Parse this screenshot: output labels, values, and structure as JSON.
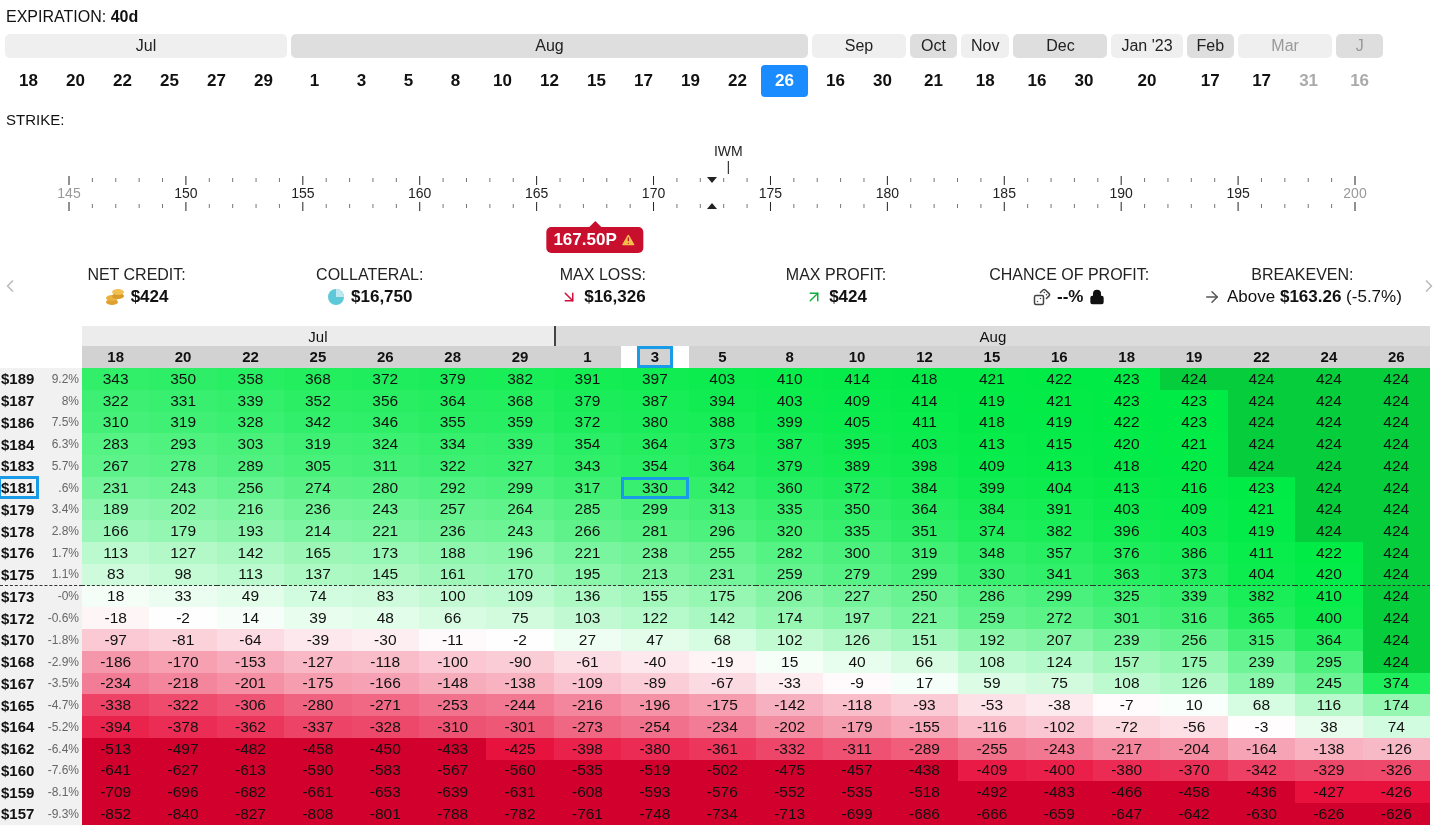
{
  "expiration": {
    "label": "EXPIRATION:",
    "days": "40d",
    "months": [
      {
        "label": "Jul",
        "dimmed": false,
        "dates": [
          {
            "label": "18",
            "selected": false,
            "dimmed": false
          },
          {
            "label": "20",
            "selected": false,
            "dimmed": false
          },
          {
            "label": "22",
            "selected": false,
            "dimmed": false
          },
          {
            "label": "25",
            "selected": false,
            "dimmed": false
          },
          {
            "label": "27",
            "selected": false,
            "dimmed": false
          },
          {
            "label": "29",
            "selected": false,
            "dimmed": false
          }
        ]
      },
      {
        "label": "Aug",
        "dimmed": false,
        "dates": [
          {
            "label": "1",
            "selected": false,
            "dimmed": false
          },
          {
            "label": "3",
            "selected": false,
            "dimmed": false
          },
          {
            "label": "5",
            "selected": false,
            "dimmed": false
          },
          {
            "label": "8",
            "selected": false,
            "dimmed": false
          },
          {
            "label": "10",
            "selected": false,
            "dimmed": false
          },
          {
            "label": "12",
            "selected": false,
            "dimmed": false
          },
          {
            "label": "15",
            "selected": false,
            "dimmed": false
          },
          {
            "label": "17",
            "selected": false,
            "dimmed": false
          },
          {
            "label": "19",
            "selected": false,
            "dimmed": false
          },
          {
            "label": "22",
            "selected": false,
            "dimmed": false
          },
          {
            "label": "26",
            "selected": true,
            "dimmed": false
          }
        ]
      },
      {
        "label": "Sep",
        "dimmed": false,
        "dates": [
          {
            "label": "16",
            "selected": false,
            "dimmed": false
          },
          {
            "label": "30",
            "selected": false,
            "dimmed": false
          }
        ]
      },
      {
        "label": "Oct",
        "dimmed": false,
        "dates": [
          {
            "label": "21",
            "selected": false,
            "dimmed": false
          }
        ]
      },
      {
        "label": "Nov",
        "dimmed": false,
        "dates": [
          {
            "label": "18",
            "selected": false,
            "dimmed": false
          }
        ]
      },
      {
        "label": "Dec",
        "dimmed": false,
        "dates": [
          {
            "label": "16",
            "selected": false,
            "dimmed": false
          },
          {
            "label": "30",
            "selected": false,
            "dimmed": false
          }
        ]
      },
      {
        "label": "Jan '23",
        "dimmed": false,
        "dates": [
          {
            "label": "20",
            "selected": false,
            "dimmed": false
          }
        ]
      },
      {
        "label": "Feb",
        "dimmed": false,
        "dates": [
          {
            "label": "17",
            "selected": false,
            "dimmed": false
          }
        ]
      },
      {
        "label": "Mar",
        "dimmed": true,
        "dates": [
          {
            "label": "17",
            "selected": false,
            "dimmed": false
          },
          {
            "label": "31",
            "selected": false,
            "dimmed": true
          }
        ]
      },
      {
        "label": "J",
        "dimmed": true,
        "dates": [
          {
            "label": "16",
            "selected": false,
            "dimmed": true
          }
        ]
      }
    ]
  },
  "strike": {
    "label": "STRIKE:",
    "ticks": [
      "145",
      "150",
      "155",
      "160",
      "165",
      "170",
      "175",
      "180",
      "185",
      "190",
      "195",
      "200"
    ],
    "underlying": "IWM",
    "selected_strike": "167.50P"
  },
  "stats": [
    {
      "kind": "coins",
      "label": "NET CREDIT:",
      "value": "$424"
    },
    {
      "kind": "pie",
      "label": "COLLATERAL:",
      "value": "$16,750"
    },
    {
      "kind": "loss",
      "label": "MAX LOSS:",
      "value": "$16,326"
    },
    {
      "kind": "profit",
      "label": "MAX PROFIT:",
      "value": "$424"
    },
    {
      "kind": "chance",
      "label": "CHANCE OF PROFIT:",
      "value": "--%"
    },
    {
      "kind": "breakeven",
      "label": "BREAKEVEN:",
      "value": "Above **$163.26** (-5.7%)"
    }
  ],
  "pnl_table": {
    "months": [
      {
        "label": "Jul",
        "dates": [
          {
            "label": "18",
            "selected": false
          },
          {
            "label": "20",
            "selected": false
          },
          {
            "label": "22",
            "selected": false
          },
          {
            "label": "25",
            "selected": false
          },
          {
            "label": "26",
            "selected": false
          },
          {
            "label": "28",
            "selected": false
          },
          {
            "label": "29",
            "selected": false
          }
        ]
      },
      {
        "label": "Aug",
        "dates": [
          {
            "label": "1",
            "selected": false
          },
          {
            "label": "3",
            "selected": true
          },
          {
            "label": "5",
            "selected": false
          },
          {
            "label": "8",
            "selected": false
          },
          {
            "label": "10",
            "selected": false
          },
          {
            "label": "12",
            "selected": false
          },
          {
            "label": "15",
            "selected": false
          },
          {
            "label": "16",
            "selected": false
          },
          {
            "label": "18",
            "selected": false
          },
          {
            "label": "19",
            "selected": false
          },
          {
            "label": "22",
            "selected": false
          },
          {
            "label": "24",
            "selected": false
          },
          {
            "label": "26",
            "selected": false
          }
        ]
      }
    ],
    "rows": [
      {
        "price": "$189",
        "change": "9.2%",
        "selected": false,
        "divider_below": false,
        "values": [
          "343",
          "350",
          "358",
          "368",
          "372",
          "379",
          "382",
          "391",
          "397",
          "403",
          "410",
          "414",
          "418",
          "421",
          "422",
          "423",
          "424",
          "424",
          "424",
          "424"
        ]
      },
      {
        "price": "$187",
        "change": "8%",
        "selected": false,
        "divider_below": false,
        "values": [
          "322",
          "331",
          "339",
          "352",
          "356",
          "364",
          "368",
          "379",
          "387",
          "394",
          "403",
          "409",
          "414",
          "419",
          "421",
          "423",
          "423",
          "424",
          "424",
          "424"
        ]
      },
      {
        "price": "$186",
        "change": "7.5%",
        "selected": false,
        "divider_below": false,
        "values": [
          "310",
          "319",
          "328",
          "342",
          "346",
          "355",
          "359",
          "372",
          "380",
          "388",
          "399",
          "405",
          "411",
          "418",
          "419",
          "422",
          "423",
          "424",
          "424",
          "424"
        ]
      },
      {
        "price": "$184",
        "change": "6.3%",
        "selected": false,
        "divider_below": false,
        "values": [
          "283",
          "293",
          "303",
          "319",
          "324",
          "334",
          "339",
          "354",
          "364",
          "373",
          "387",
          "395",
          "403",
          "413",
          "415",
          "420",
          "421",
          "424",
          "424",
          "424"
        ]
      },
      {
        "price": "$183",
        "change": "5.7%",
        "selected": false,
        "divider_below": false,
        "values": [
          "267",
          "278",
          "289",
          "305",
          "311",
          "322",
          "327",
          "343",
          "354",
          "364",
          "379",
          "389",
          "398",
          "409",
          "413",
          "418",
          "420",
          "424",
          "424",
          "424"
        ]
      },
      {
        "price": "$181",
        "change": ".6%",
        "selected": true,
        "divider_below": false,
        "values": [
          "231",
          "243",
          "256",
          "274",
          "280",
          "292",
          "299",
          "317",
          "330",
          "342",
          "360",
          "372",
          "384",
          "399",
          "404",
          "413",
          "416",
          "423",
          "424",
          "424"
        ]
      },
      {
        "price": "$179",
        "change": "3.4%",
        "selected": false,
        "divider_below": false,
        "values": [
          "189",
          "202",
          "216",
          "236",
          "243",
          "257",
          "264",
          "285",
          "299",
          "313",
          "335",
          "350",
          "364",
          "384",
          "391",
          "403",
          "409",
          "421",
          "424",
          "424"
        ]
      },
      {
        "price": "$178",
        "change": "2.8%",
        "selected": false,
        "divider_below": false,
        "values": [
          "166",
          "179",
          "193",
          "214",
          "221",
          "236",
          "243",
          "266",
          "281",
          "296",
          "320",
          "335",
          "351",
          "374",
          "382",
          "396",
          "403",
          "419",
          "424",
          "424"
        ]
      },
      {
        "price": "$176",
        "change": "1.7%",
        "selected": false,
        "divider_below": false,
        "values": [
          "113",
          "127",
          "142",
          "165",
          "173",
          "188",
          "196",
          "221",
          "238",
          "255",
          "282",
          "300",
          "319",
          "348",
          "357",
          "376",
          "386",
          "411",
          "422",
          "424"
        ]
      },
      {
        "price": "$175",
        "change": "1.1%",
        "selected": false,
        "divider_below": true,
        "values": [
          "83",
          "98",
          "113",
          "137",
          "145",
          "161",
          "170",
          "195",
          "213",
          "231",
          "259",
          "279",
          "299",
          "330",
          "341",
          "363",
          "373",
          "404",
          "420",
          "424"
        ]
      },
      {
        "price": "$173",
        "change": "-0%",
        "selected": false,
        "divider_below": false,
        "values": [
          "18",
          "33",
          "49",
          "74",
          "83",
          "100",
          "109",
          "136",
          "155",
          "175",
          "206",
          "227",
          "250",
          "286",
          "299",
          "325",
          "339",
          "382",
          "410",
          "424"
        ]
      },
      {
        "price": "$172",
        "change": "-0.6%",
        "selected": false,
        "divider_below": false,
        "values": [
          "-18",
          "-2",
          "14",
          "39",
          "48",
          "66",
          "75",
          "103",
          "122",
          "142",
          "174",
          "197",
          "221",
          "259",
          "272",
          "301",
          "316",
          "365",
          "400",
          "424"
        ]
      },
      {
        "price": "$170",
        "change": "-1.8%",
        "selected": false,
        "divider_below": false,
        "values": [
          "-97",
          "-81",
          "-64",
          "-39",
          "-30",
          "-11",
          "-2",
          "27",
          "47",
          "68",
          "102",
          "126",
          "151",
          "192",
          "207",
          "239",
          "256",
          "315",
          "364",
          "424"
        ]
      },
      {
        "price": "$168",
        "change": "-2.9%",
        "selected": false,
        "divider_below": false,
        "values": [
          "-186",
          "-170",
          "-153",
          "-127",
          "-118",
          "-100",
          "-90",
          "-61",
          "-40",
          "-19",
          "15",
          "40",
          "66",
          "108",
          "124",
          "157",
          "175",
          "239",
          "295",
          "424"
        ]
      },
      {
        "price": "$167",
        "change": "-3.5%",
        "selected": false,
        "divider_below": false,
        "values": [
          "-234",
          "-218",
          "-201",
          "-175",
          "-166",
          "-148",
          "-138",
          "-109",
          "-89",
          "-67",
          "-33",
          "-9",
          "17",
          "59",
          "75",
          "108",
          "126",
          "189",
          "245",
          "374"
        ]
      },
      {
        "price": "$165",
        "change": "-4.7%",
        "selected": false,
        "divider_below": false,
        "values": [
          "-338",
          "-322",
          "-306",
          "-280",
          "-271",
          "-253",
          "-244",
          "-216",
          "-196",
          "-175",
          "-142",
          "-118",
          "-93",
          "-53",
          "-38",
          "-7",
          "10",
          "68",
          "116",
          "174"
        ]
      },
      {
        "price": "$164",
        "change": "-5.2%",
        "selected": false,
        "divider_below": false,
        "values": [
          "-394",
          "-378",
          "-362",
          "-337",
          "-328",
          "-310",
          "-301",
          "-273",
          "-254",
          "-234",
          "-202",
          "-179",
          "-155",
          "-116",
          "-102",
          "-72",
          "-56",
          "-3",
          "38",
          "74"
        ]
      },
      {
        "price": "$162",
        "change": "-6.4%",
        "selected": false,
        "divider_below": false,
        "values": [
          "-513",
          "-497",
          "-482",
          "-458",
          "-450",
          "-433",
          "-425",
          "-398",
          "-380",
          "-361",
          "-332",
          "-311",
          "-289",
          "-255",
          "-243",
          "-217",
          "-204",
          "-164",
          "-138",
          "-126"
        ]
      },
      {
        "price": "$160",
        "change": "-7.6%",
        "selected": false,
        "divider_below": false,
        "values": [
          "-641",
          "-627",
          "-613",
          "-590",
          "-583",
          "-567",
          "-560",
          "-535",
          "-519",
          "-502",
          "-475",
          "-457",
          "-438",
          "-409",
          "-400",
          "-380",
          "-370",
          "-342",
          "-329",
          "-326"
        ]
      },
      {
        "price": "$159",
        "change": "-8.1%",
        "selected": false,
        "divider_below": false,
        "values": [
          "-709",
          "-696",
          "-682",
          "-661",
          "-653",
          "-639",
          "-631",
          "-608",
          "-593",
          "-576",
          "-552",
          "-535",
          "-518",
          "-492",
          "-483",
          "-466",
          "-458",
          "-436",
          "-427",
          "-426"
        ]
      },
      {
        "price": "$157",
        "change": "-9.3%",
        "selected": false,
        "divider_below": false,
        "values": [
          "-852",
          "-840",
          "-827",
          "-808",
          "-801",
          "-788",
          "-782",
          "-761",
          "-748",
          "-734",
          "-713",
          "-699",
          "-686",
          "-666",
          "-659",
          "-647",
          "-642",
          "-630",
          "-626",
          "-626"
        ]
      }
    ]
  }
}
